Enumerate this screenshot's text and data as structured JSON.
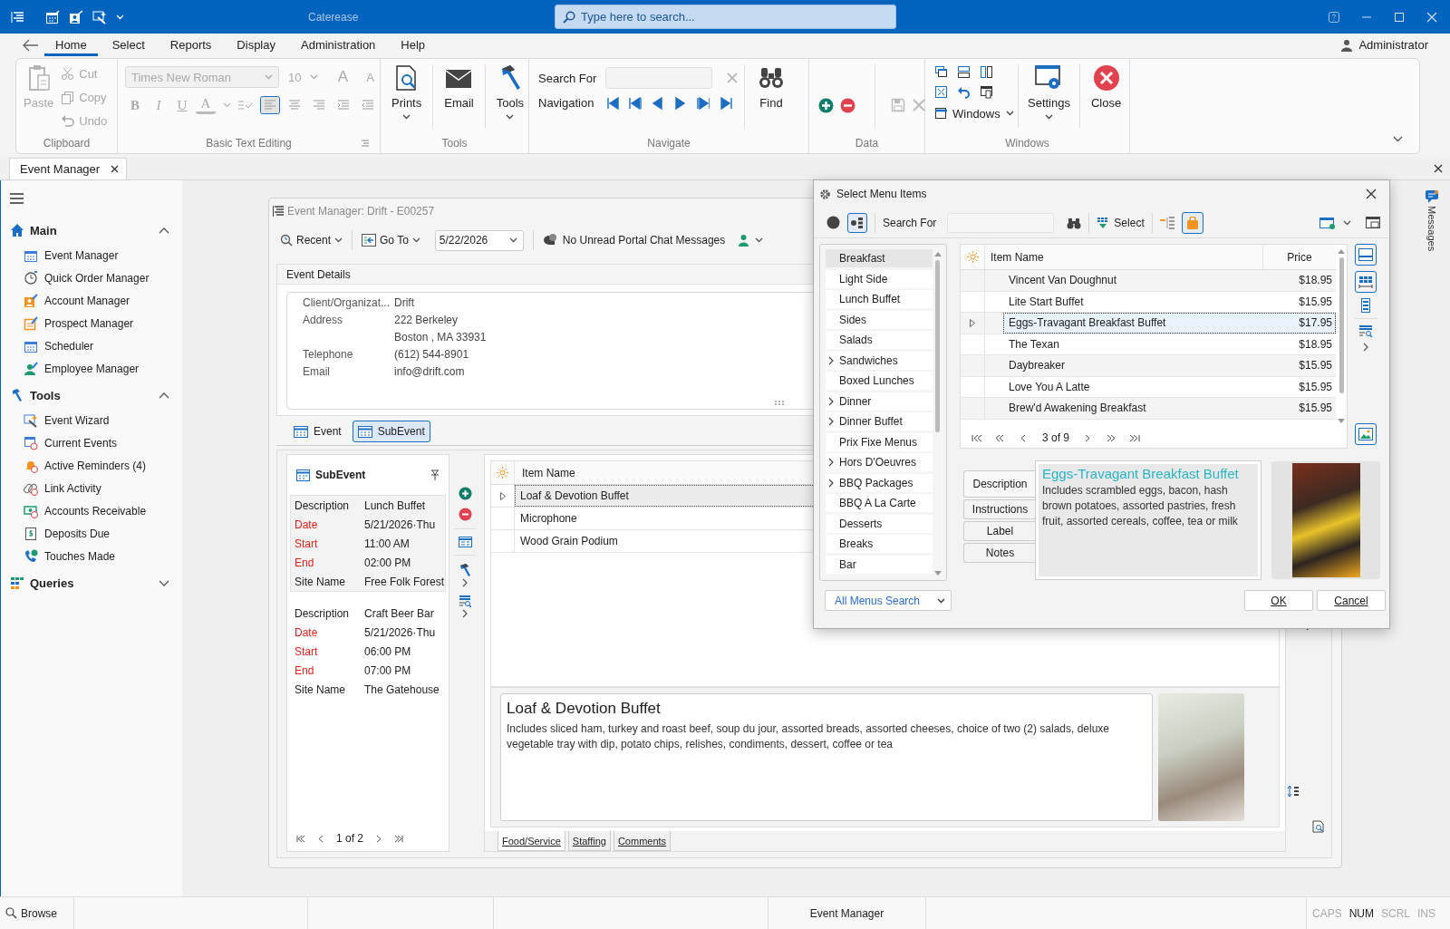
{
  "window": {
    "title": "Caterease",
    "search_placeholder": "Type here to search..."
  },
  "menu_tabs": [
    {
      "label": "Home",
      "selected": true
    },
    {
      "label": "Select",
      "selected": false
    },
    {
      "label": "Reports",
      "selected": false
    },
    {
      "label": "Display",
      "selected": false
    },
    {
      "label": "Administration",
      "selected": false
    },
    {
      "label": "Help",
      "selected": false
    }
  ],
  "user": "Administrator",
  "ribbon": {
    "clipboard": {
      "label": "Clipboard",
      "paste": {
        "label": "Paste",
        "disabled": true
      },
      "items": [
        {
          "label": "Cut",
          "disabled": true
        },
        {
          "label": "Copy",
          "disabled": true
        },
        {
          "label": "Undo",
          "disabled": true
        }
      ]
    },
    "text_editing": {
      "label": "Basic Text Editing",
      "font": "Times New Roman",
      "size": "10",
      "disabled": true,
      "size_buttons": [
        "A",
        "A"
      ],
      "format_buttons": [
        "B",
        "I",
        "U",
        "A"
      ]
    },
    "tools": {
      "label": "Tools",
      "buttons": [
        {
          "label": "Prints",
          "dropdown": true
        },
        {
          "label": "Email",
          "dropdown": false
        },
        {
          "label": "Tools",
          "dropdown": true
        }
      ]
    },
    "navigate": {
      "label": "Navigate",
      "search_label": "Search For",
      "navigation_label": "Navigation",
      "find": "Find"
    },
    "data": {
      "label": "Data"
    },
    "windows": {
      "label": "Windows",
      "windows_button": "Windows",
      "settings": "Settings",
      "close": "Close"
    }
  },
  "document_tabs": [
    {
      "label": "Event Manager",
      "selected": true
    }
  ],
  "sidebar": {
    "sections": [
      {
        "title": "Main",
        "expanded": true,
        "items": [
          "Event Manager",
          "Quick Order Manager",
          "Account Manager",
          "Prospect Manager",
          "Scheduler",
          "Employee Manager"
        ]
      },
      {
        "title": "Tools",
        "expanded": true,
        "items": [
          "Event Wizard",
          "Current Events",
          "Active Reminders (4)",
          "Link Activity",
          "Accounts Receivable",
          "Deposits Due",
          "Touches Made"
        ]
      },
      {
        "title": "Queries",
        "expanded": false
      }
    ]
  },
  "event_window": {
    "title": "Event Manager: Drift - E00257",
    "toolbar": {
      "recent": "Recent",
      "go_to": "Go To",
      "date": "5/22/2026",
      "chat_status": "No Unread Portal Chat Messages"
    },
    "details": {
      "title": "Event Details",
      "fields": [
        {
          "label": "Client/Organizat...",
          "values": [
            "Drift"
          ]
        },
        {
          "label": "Address",
          "values": [
            "222 Berkeley",
            "Boston , MA 33931"
          ]
        },
        {
          "label": "Telephone",
          "values": [
            "(612) 544-8901"
          ]
        },
        {
          "label": "Email",
          "values": [
            "info@drift.com"
          ]
        }
      ]
    },
    "view_tabs": [
      {
        "label": "Event",
        "selected": false
      },
      {
        "label": "SubEvent",
        "selected": true
      }
    ],
    "subevent": {
      "title": "SubEvent",
      "pager": "1 of 2",
      "records": [
        {
          "selected": true,
          "fields": [
            {
              "label": "Description",
              "value": "Lunch Buffet",
              "required": false
            },
            {
              "label": "Date",
              "value": "5/21/2026·Thu",
              "required": true
            },
            {
              "label": "Start",
              "value": "11:00 AM",
              "required": true
            },
            {
              "label": "End",
              "value": "02:00 PM",
              "required": true
            },
            {
              "label": "Site Name",
              "value": "Free Folk Forest",
              "required": false
            }
          ]
        },
        {
          "selected": false,
          "fields": [
            {
              "label": "Description",
              "value": "Craft Beer Bar",
              "required": false
            },
            {
              "label": "Date",
              "value": "5/21/2026·Thu",
              "required": true
            },
            {
              "label": "Start",
              "value": "06:00 PM",
              "required": true
            },
            {
              "label": "End",
              "value": "07:00 PM",
              "required": true
            },
            {
              "label": "Site Name",
              "value": "The Gatehouse",
              "required": false
            }
          ]
        }
      ]
    },
    "items": {
      "column": "Item Name",
      "rows": [
        {
          "name": "Loaf & Devotion Buffet",
          "selected": true
        },
        {
          "name": "Microphone",
          "selected": false
        },
        {
          "name": "Wood Grain Podium",
          "selected": false
        }
      ],
      "detail": {
        "title": "Loaf & Devotion Buffet",
        "text": "Includes sliced ham, turkey and roast beef, soup du jour, assorted breads, assorted cheeses, choice of two (2) salads, deluxe vegetable tray with dip, potato chips, relishes, condiments, dessert, coffee or tea"
      },
      "tabs": [
        {
          "label": "Food/Service",
          "selected": true
        },
        {
          "label": "Staffing",
          "selected": false
        },
        {
          "label": "Comments",
          "selected": false
        }
      ]
    }
  },
  "messages_label": "Messages",
  "dialog": {
    "title": "Select Menu Items",
    "search_label": "Search For",
    "select_button": "Select",
    "categories": [
      {
        "label": "Breakfast",
        "selected": true,
        "expandable": false
      },
      {
        "label": "Light Side",
        "selected": false,
        "expandable": false
      },
      {
        "label": "Lunch Buffet",
        "selected": false,
        "expandable": false
      },
      {
        "label": "Sides",
        "selected": false,
        "expandable": false
      },
      {
        "label": "Salads",
        "selected": false,
        "expandable": false
      },
      {
        "label": "Sandwiches",
        "selected": false,
        "expandable": true
      },
      {
        "label": "Boxed Lunches",
        "selected": false,
        "expandable": false
      },
      {
        "label": "Dinner",
        "selected": false,
        "expandable": true
      },
      {
        "label": "Dinner Buffet",
        "selected": false,
        "expandable": true
      },
      {
        "label": "Prix Fixe Menus",
        "selected": false,
        "expandable": false
      },
      {
        "label": "Hors D'Oeuvres",
        "selected": false,
        "expandable": true
      },
      {
        "label": "BBQ Packages",
        "selected": false,
        "expandable": true
      },
      {
        "label": "BBQ A La Carte",
        "selected": false,
        "expandable": false
      },
      {
        "label": "Desserts",
        "selected": false,
        "expandable": false
      },
      {
        "label": "Breaks",
        "selected": false,
        "expandable": false
      },
      {
        "label": "Bar",
        "selected": false,
        "expandable": false
      }
    ],
    "columns": [
      "Item Name",
      "Price"
    ],
    "rows": [
      {
        "name": "Vincent Van Doughnut",
        "price": "$18.95",
        "selected": false
      },
      {
        "name": "Lite Start Buffet",
        "price": "$15.95",
        "selected": false
      },
      {
        "name": "Eggs-Travagant Breakfast Buffet",
        "price": "$17.95",
        "selected": true
      },
      {
        "name": "The Texan",
        "price": "$18.95",
        "selected": false
      },
      {
        "name": "Daybreaker",
        "price": "$15.95",
        "selected": false
      },
      {
        "name": "Love You A Latte",
        "price": "$15.95",
        "selected": false
      },
      {
        "name": "Brew'd Awakening Breakfast",
        "price": "$15.95",
        "selected": false
      }
    ],
    "pager": "3 of 9",
    "detail_tabs": [
      {
        "label": "Description",
        "selected": true
      },
      {
        "label": "Instructions",
        "selected": false
      },
      {
        "label": "Label",
        "selected": false
      },
      {
        "label": "Notes",
        "selected": false
      }
    ],
    "detail": {
      "title": "Eggs-Travagant Breakfast Buffet",
      "text": "Includes scrambled eggs, bacon, hash brown potatoes, assorted pastries, fresh fruit, assorted cereals, coffee, tea or milk"
    },
    "scope": "All Menus Search",
    "buttons": [
      "OK",
      "Cancel"
    ]
  },
  "status_bar": {
    "mode": "Browse",
    "module": "Event Manager",
    "indicators": [
      {
        "label": "CAPS",
        "on": false
      },
      {
        "label": "NUM",
        "on": true
      },
      {
        "label": "SCRL",
        "on": false
      },
      {
        "label": "INS",
        "on": false
      }
    ]
  }
}
